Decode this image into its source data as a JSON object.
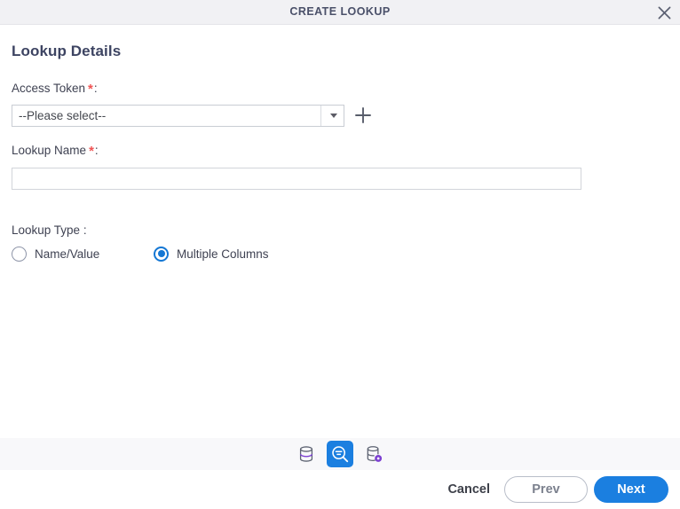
{
  "window": {
    "title": "CREATE LOOKUP",
    "close_icon": "close-icon"
  },
  "form": {
    "section_title": "Lookup Details",
    "access_token": {
      "label": "Access Token",
      "required_marker": "*",
      "colon": ":",
      "selected_value": "--Please select--",
      "add_icon": "plus-icon"
    },
    "lookup_name": {
      "label": "Lookup Name",
      "required_marker": "*",
      "colon": ":",
      "value": "",
      "placeholder": ""
    },
    "lookup_type": {
      "label": "Lookup Type :",
      "options": [
        {
          "label": "Name/Value",
          "selected": false
        },
        {
          "label": "Multiple Columns",
          "selected": true
        }
      ]
    }
  },
  "steps": [
    {
      "name": "database-icon",
      "active": false
    },
    {
      "name": "lookup-search-icon",
      "active": true
    },
    {
      "name": "database-settings-icon",
      "active": false
    }
  ],
  "footer": {
    "cancel_label": "Cancel",
    "prev_label": "Prev",
    "next_label": "Next"
  },
  "colors": {
    "accent_blue": "#1b7fe0",
    "radio_blue": "#1477d4",
    "required_red": "#f05454",
    "purple": "#7c3fd1",
    "title_text": "#4a5069",
    "header_bg": "#f1f1f4",
    "strip_bg": "#f8f8fa"
  }
}
